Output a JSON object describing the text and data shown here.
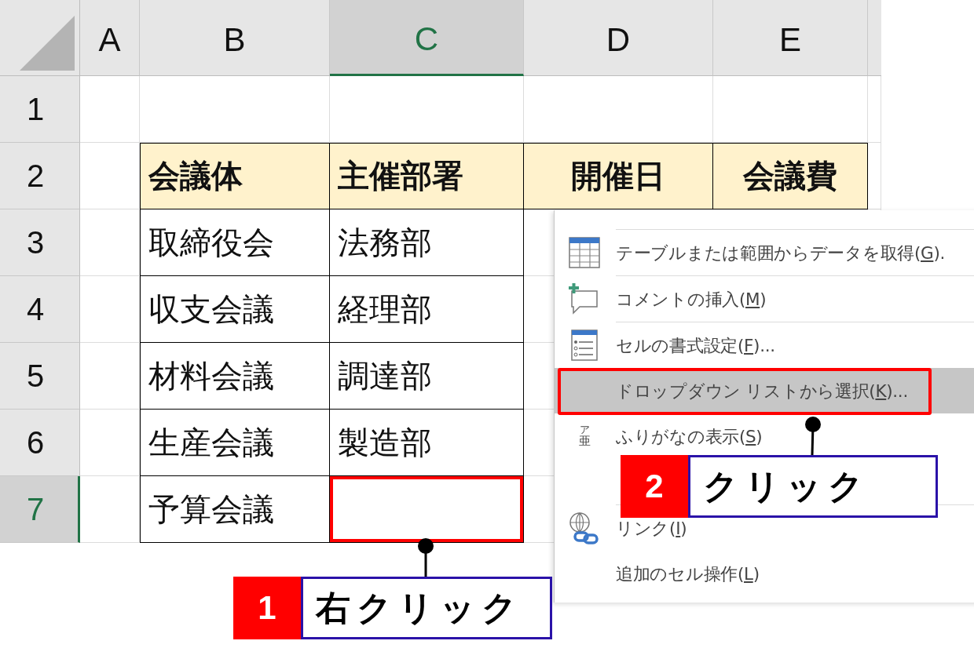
{
  "columns": [
    {
      "label": "A",
      "selected": false
    },
    {
      "label": "B",
      "selected": false
    },
    {
      "label": "C",
      "selected": true
    },
    {
      "label": "D",
      "selected": false
    },
    {
      "label": "E",
      "selected": false
    }
  ],
  "rows": [
    {
      "label": "1",
      "selected": false,
      "kind": "blank"
    },
    {
      "label": "2",
      "selected": false,
      "kind": "header",
      "cells": [
        "会議体",
        "主催部署",
        "開催日",
        "会議費"
      ]
    },
    {
      "label": "3",
      "selected": false,
      "kind": "data",
      "cells": [
        "取締役会",
        "法務部"
      ]
    },
    {
      "label": "4",
      "selected": false,
      "kind": "data",
      "cells": [
        "収支会議",
        "経理部"
      ]
    },
    {
      "label": "5",
      "selected": false,
      "kind": "data",
      "cells": [
        "材料会議",
        "調達部"
      ]
    },
    {
      "label": "6",
      "selected": false,
      "kind": "data",
      "cells": [
        "生産会議",
        "製造部"
      ]
    },
    {
      "label": "7",
      "selected": true,
      "kind": "data",
      "cells": [
        "予算会議"
      ]
    }
  ],
  "context_menu": {
    "items": [
      {
        "kind": "table",
        "label": "テーブルまたは範囲からデータを取得(",
        "key": "G",
        "suffix": ").",
        "selected": false
      },
      {
        "kind": "comment",
        "label": "コメントの挿入(",
        "key": "M",
        "suffix": ")",
        "selected": false
      },
      {
        "kind": "format",
        "label": "セルの書式設定(",
        "key": "F",
        "suffix": ")...",
        "selected": false
      },
      {
        "kind": "plain",
        "label": "ドロップダウン リストから選択(",
        "key": "K",
        "suffix": ")...",
        "selected": true
      },
      {
        "kind": "furigana",
        "icon_text": [
          "ア",
          "亜"
        ],
        "label": "ふりがなの表示(",
        "key": "S",
        "suffix": ")",
        "selected": false
      },
      {
        "kind": "hidden"
      },
      {
        "kind": "link",
        "label": "リンク(",
        "key": "I",
        "suffix": ")",
        "selected": false
      },
      {
        "kind": "plain",
        "label": "追加のセル操作(",
        "key": "L",
        "suffix": ")",
        "selected": false
      }
    ]
  },
  "callouts": [
    {
      "number": "1",
      "label": "右クリック"
    },
    {
      "number": "2",
      "label": "クリック"
    }
  ]
}
